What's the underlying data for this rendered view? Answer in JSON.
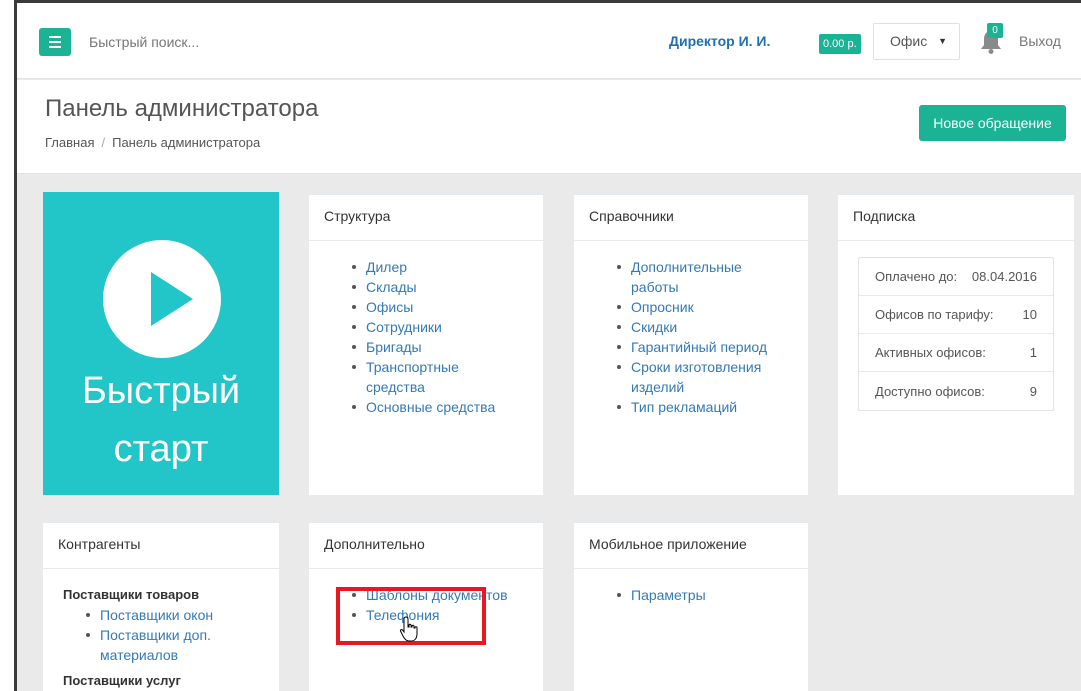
{
  "topbar": {
    "search_placeholder": "Быстрый поиск...",
    "user_name": "Директор И. И.",
    "balance": "0.00 р.",
    "office_select": "Офис",
    "notifications_count": "0",
    "logout": "Выход"
  },
  "heading": {
    "title": "Панель администратора",
    "breadcrumb": [
      "Главная",
      "Панель администратора"
    ],
    "new_ticket": "Новое обращение"
  },
  "quickstart": {
    "line1": "Быстрый",
    "line2": "старт"
  },
  "structure": {
    "title": "Структура",
    "items": [
      "Дилер",
      "Склады",
      "Офисы",
      "Сотрудники",
      "Бригады",
      "Транспортные средства",
      "Основные средства"
    ]
  },
  "directories": {
    "title": "Справочники",
    "items": [
      "Дополнительные работы",
      "Опросник",
      "Скидки",
      "Гарантийный период",
      "Сроки изготовления изделий",
      "Тип рекламаций"
    ]
  },
  "subscription": {
    "title": "Подписка",
    "rows": [
      {
        "label": "Оплачено до:",
        "value": "08.04.2016"
      },
      {
        "label": "Офисов по тарифу:",
        "value": "10"
      },
      {
        "label": "Активных офисов:",
        "value": "1"
      },
      {
        "label": "Доступно офисов:",
        "value": "9"
      }
    ]
  },
  "contractors": {
    "title": "Контрагенты",
    "group1": "Поставщики товаров",
    "group1_items": [
      "Поставщики окон",
      "Поставщики доп. материалов"
    ],
    "group2": "Поставщики услуг"
  },
  "additional": {
    "title": "Дополнительно",
    "items": [
      "Шаблоны документов",
      "Телефония"
    ]
  },
  "mobile": {
    "title": "Мобильное приложение",
    "items": [
      "Параметры"
    ]
  },
  "colors": {
    "accent": "#1ab394",
    "quickstart": "#23c6c8",
    "link": "#337ab7",
    "highlight": "#e8181e"
  }
}
